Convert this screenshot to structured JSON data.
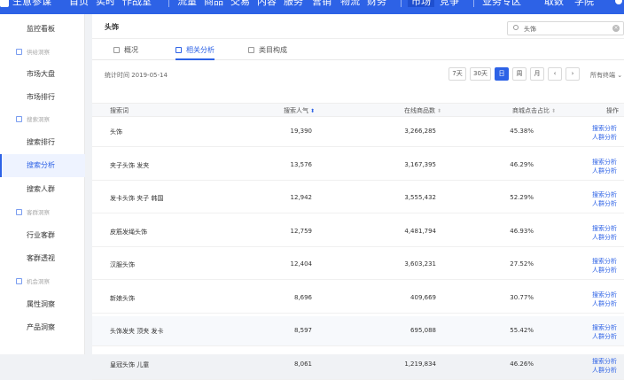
{
  "topnav": {
    "items": [
      {
        "label": "生意参谋"
      },
      {
        "label": "首页"
      },
      {
        "label": "实时"
      },
      {
        "label": "作战室"
      },
      {
        "label": "流量"
      },
      {
        "label": "商品"
      },
      {
        "label": "交易"
      },
      {
        "label": "内容"
      },
      {
        "label": "服务"
      },
      {
        "label": "营销"
      },
      {
        "label": "物流"
      },
      {
        "label": "财务"
      },
      {
        "label": "市场"
      },
      {
        "label": "竞争"
      },
      {
        "label": "业务专区"
      },
      {
        "label": "取数"
      },
      {
        "label": "学院"
      }
    ]
  },
  "sidebar": {
    "top_item": "监控看板",
    "groups": [
      {
        "title": "供给洞察",
        "items": [
          "市场大盘",
          "市场排行"
        ]
      },
      {
        "title": "搜索洞察",
        "items": [
          "搜索排行",
          "搜索分析",
          "搜索人群"
        ]
      },
      {
        "title": "客群洞察",
        "items": [
          "行业客群",
          "客群透视"
        ]
      },
      {
        "title": "机会洞察",
        "items": [
          "属性洞察",
          "产品洞察"
        ]
      }
    ],
    "active_item": "搜索分析"
  },
  "main": {
    "title": "头饰",
    "search_value": "头饰",
    "tabs": [
      "概况",
      "相关分析",
      "类目构成"
    ],
    "active_tab": "相关分析",
    "stat_date": "统计时间 2019-05-14",
    "periods": [
      "7天",
      "30天",
      "日",
      "周",
      "月"
    ],
    "active_period": "日",
    "prev_arrow": "‹",
    "next_arrow": "›",
    "device_select": "所有终端 ⌄"
  },
  "table": {
    "columns": [
      "搜索词",
      "搜索人气",
      "在线商品数",
      "商城点击占比",
      "操作"
    ],
    "rows": [
      {
        "keyword": "头饰",
        "popularity": "19,390",
        "online_items": "3,266,285",
        "tmall_click_ratio": "45.38%"
      },
      {
        "keyword": "夹子头饰 发夹",
        "popularity": "13,576",
        "online_items": "3,167,395",
        "tmall_click_ratio": "46.29%"
      },
      {
        "keyword": "发卡头饰 夹子 韩国",
        "popularity": "12,942",
        "online_items": "3,555,432",
        "tmall_click_ratio": "52.29%"
      },
      {
        "keyword": "皮筋发绳头饰",
        "popularity": "12,759",
        "online_items": "4,481,794",
        "tmall_click_ratio": "46.93%"
      },
      {
        "keyword": "汉服头饰",
        "popularity": "12,404",
        "online_items": "3,603,231",
        "tmall_click_ratio": "27.52%"
      },
      {
        "keyword": "新娘头饰",
        "popularity": "8,696",
        "online_items": "409,669",
        "tmall_click_ratio": "30.77%"
      },
      {
        "keyword": "头饰发夹 顶夹 发卡",
        "popularity": "8,597",
        "online_items": "695,088",
        "tmall_click_ratio": "55.42%"
      },
      {
        "keyword": "皇冠头饰 儿童",
        "popularity": "8,061",
        "online_items": "1,219,834",
        "tmall_click_ratio": "46.26%"
      }
    ],
    "op_links": [
      "搜索分析",
      "人群分析"
    ]
  },
  "colors": {
    "accent": "#2d62e6",
    "nav_bg": "#2d62e6"
  }
}
